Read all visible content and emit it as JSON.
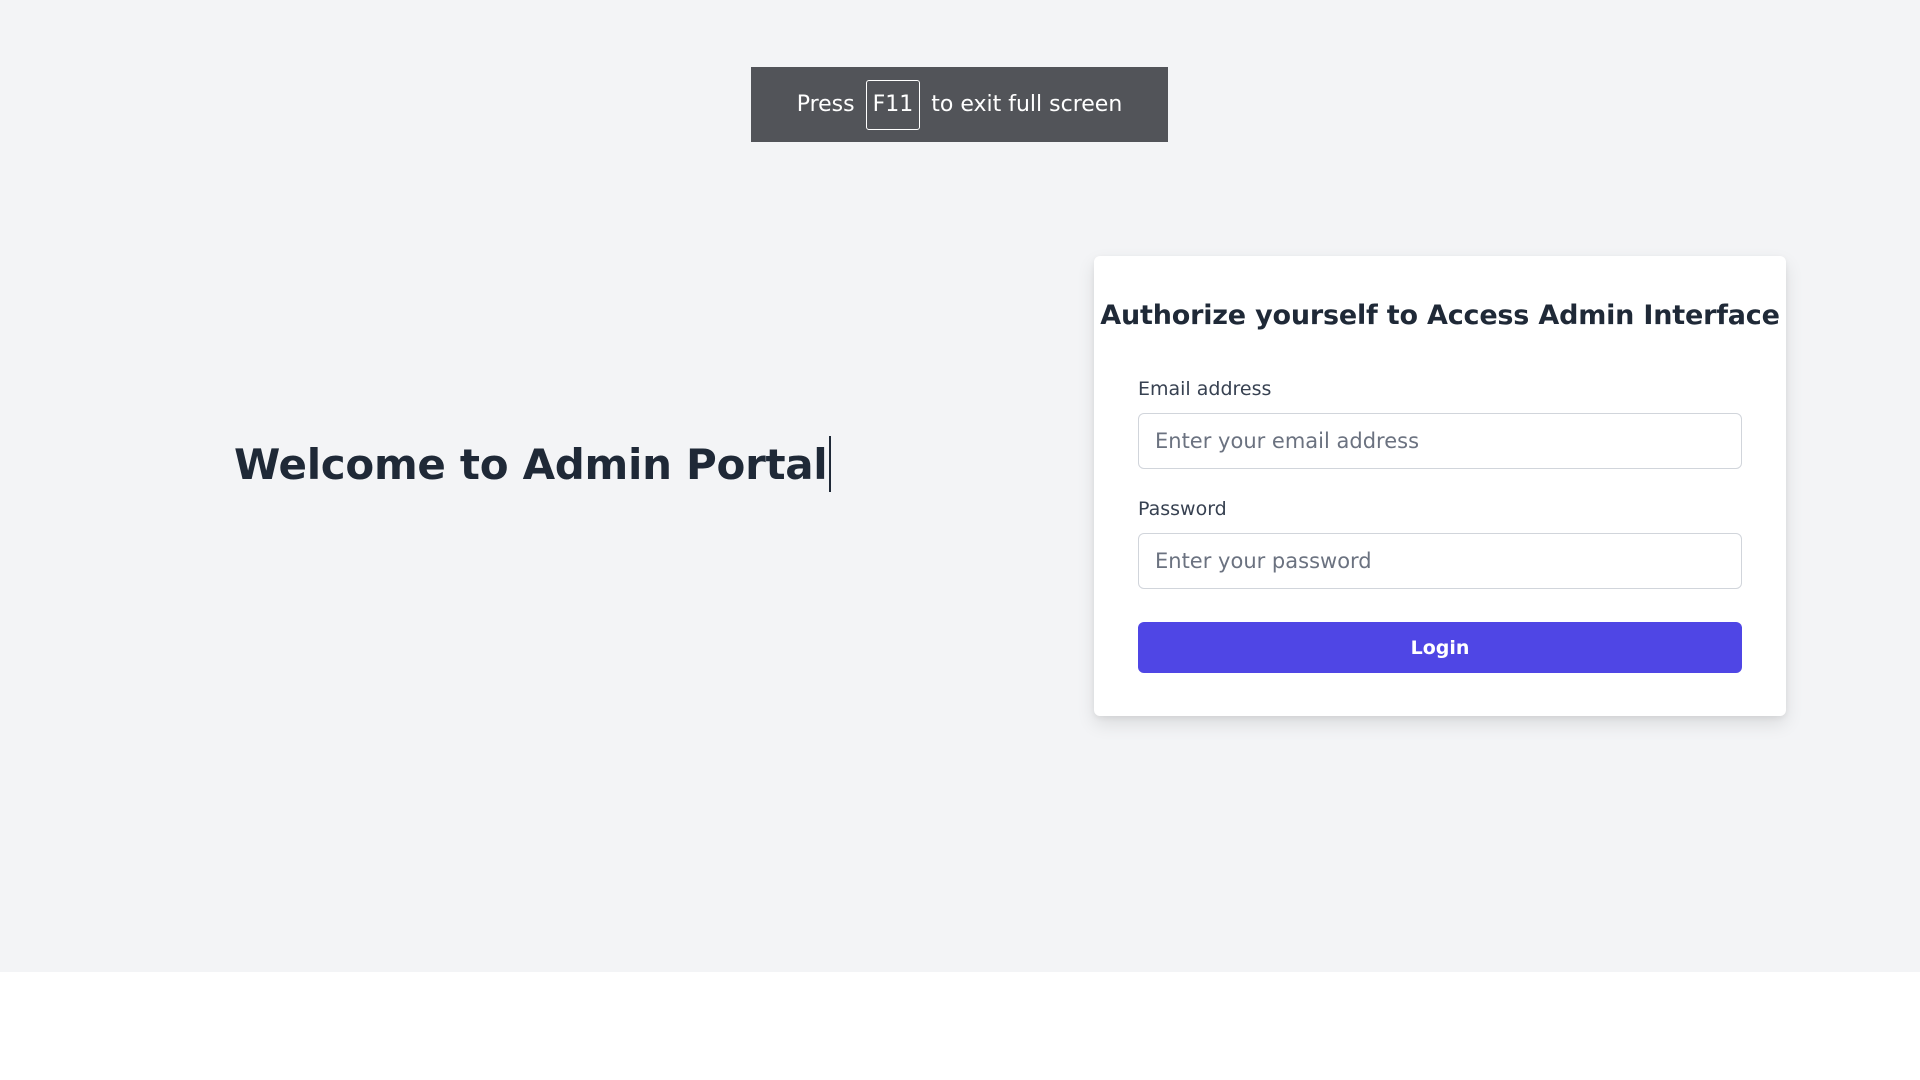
{
  "fullscreen_notice": {
    "prefix": "Press",
    "key": "F11",
    "suffix": "to exit full screen"
  },
  "welcome": {
    "heading": "Welcome to Admin Portal"
  },
  "login_card": {
    "title": "Authorize yourself to Access Admin Interface",
    "email": {
      "label": "Email address",
      "value": "",
      "placeholder": "Enter your email address"
    },
    "password": {
      "label": "Password",
      "value": "",
      "placeholder": "Enter your password"
    },
    "submit_label": "Login"
  },
  "colors": {
    "page_background": "#f3f4f6",
    "card_background": "#ffffff",
    "primary_button": "#4f46e5",
    "toast_background": "#525459",
    "text_primary": "#1f2937"
  }
}
